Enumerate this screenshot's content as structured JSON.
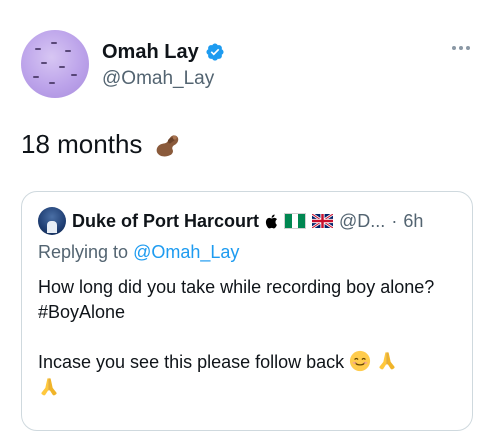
{
  "tweet": {
    "author_name": "Omah Lay",
    "author_handle": "@Omah_Lay",
    "text": "18 months",
    "text_emoji_icon": "pinching-hand-icon",
    "verified_icon": "verified-badge-icon",
    "more_icon": "more-options-icon"
  },
  "quote": {
    "author_name": "Duke of Port Harcourt",
    "badges": [
      "apple-icon",
      "nigeria-flag-icon",
      "uk-flag-icon"
    ],
    "handle_truncated": "@D...",
    "separator": "·",
    "time_ago": "6h",
    "replying_prefix": "Replying to",
    "replying_mention": "@Omah_Lay",
    "body_line1": "How long did you take while recording boy alone? #BoyAlone",
    "body_line2": "Incase you see this please follow back",
    "body_emojis": [
      "smiling-face-icon",
      "folded-hands-icon",
      "folded-hands-icon"
    ]
  },
  "colors": {
    "text": "#0f1419",
    "secondary": "#536471",
    "link": "#1d9bf0",
    "border": "#cfd9de",
    "verified": "#1d9bf0"
  }
}
